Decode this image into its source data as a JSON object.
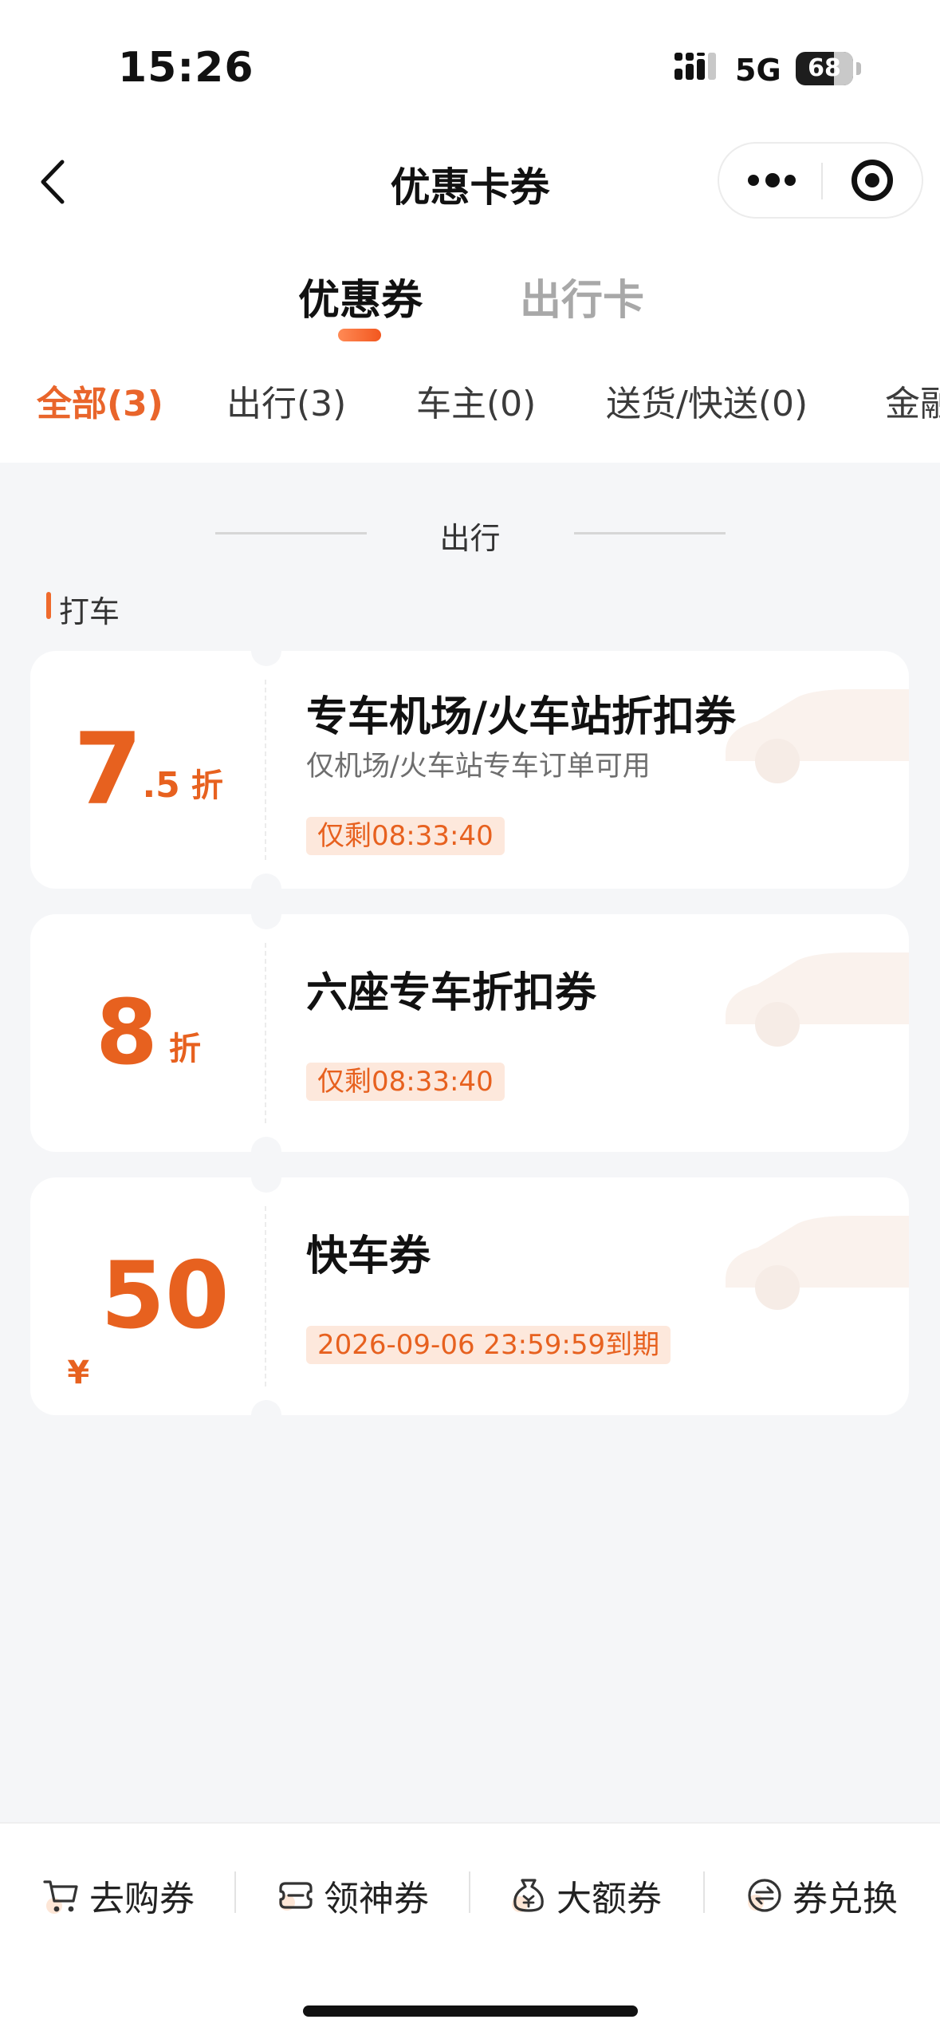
{
  "status_bar": {
    "time": "15:26",
    "network": "5G",
    "battery": "68"
  },
  "nav": {
    "title": "优惠卡券",
    "back_icon": "chevron-left-icon",
    "more_icon": "more-dots-icon",
    "close_icon": "target-close-icon"
  },
  "main_tabs": [
    {
      "label": "优惠券",
      "active": true
    },
    {
      "label": "出行卡",
      "active": false
    }
  ],
  "category_tabs": [
    {
      "label": "全部(3)",
      "active": true
    },
    {
      "label": "出行(3)",
      "active": false
    },
    {
      "label": "车主(0)",
      "active": false
    },
    {
      "label": "送货/快送(0)",
      "active": false
    },
    {
      "label": "金融",
      "active": false
    }
  ],
  "section": {
    "title": "出行",
    "group_title": "打车"
  },
  "coupons": [
    {
      "value_main": "7",
      "value_decimal": ".5",
      "unit": "折",
      "title": "专车机场/火车站折扣券",
      "description": "仅机场/火车站专车订单可用",
      "badge": "仅剩08:33:40"
    },
    {
      "value_main": "8",
      "unit": "折",
      "title": "六座专车折扣券",
      "badge": "仅剩08:33:40"
    },
    {
      "currency": "¥",
      "value_main": "50",
      "title": "快车券",
      "badge": "2026-09-06 23:59:59到期"
    }
  ],
  "bottom_bar": [
    {
      "label": "去购券",
      "icon": "cart-icon"
    },
    {
      "label": "领神券",
      "icon": "ticket-icon"
    },
    {
      "label": "大额券",
      "icon": "money-bag-icon"
    },
    {
      "label": "券兑换",
      "icon": "exchange-icon"
    }
  ],
  "colors": {
    "accent": "#e7611f",
    "badge_bg": "#fde8dc",
    "page_bg": "#f5f6f8"
  }
}
